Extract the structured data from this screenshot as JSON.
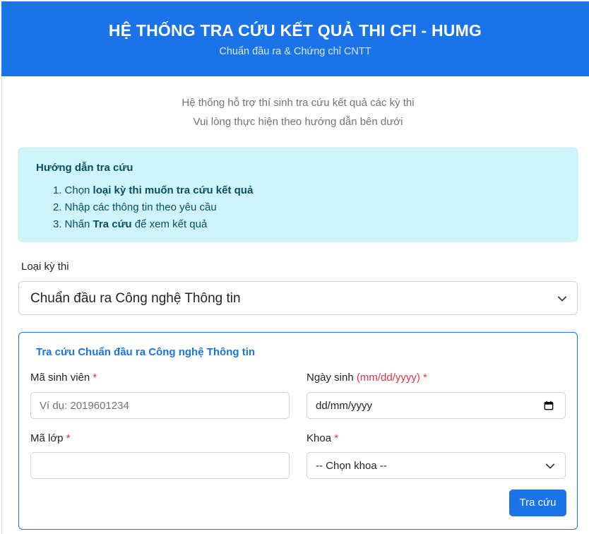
{
  "header": {
    "title": "HỆ THỐNG TRA CỨU KẾT QUẢ THI CFI - HUMG",
    "subtitle": "Chuẩn đầu ra & Chứng chỉ CNTT"
  },
  "intro": {
    "line1": "Hệ thống hỗ trợ thí sinh tra cứu kết quả các kỳ thi",
    "line2": "Vui lòng thực hiện theo hướng dẫn bên dưới"
  },
  "guide": {
    "heading": "Hướng dẫn tra cứu",
    "steps": [
      {
        "num": "1.",
        "pre": "Chọn ",
        "bold": "loại kỳ thi muốn tra cứu kết quả",
        "post": ""
      },
      {
        "num": "2.",
        "pre": "Nhập các thông tin theo yêu cầu",
        "bold": "",
        "post": ""
      },
      {
        "num": "3.",
        "pre": "Nhấn ",
        "bold": "Tra cứu",
        "post": " để xem kết quả"
      }
    ]
  },
  "exam_type": {
    "label": "Loại kỳ thi",
    "selected": "Chuẩn đầu ra Công nghệ Thông tin"
  },
  "form": {
    "title": "Tra cứu Chuẩn đầu ra Công nghệ Thông tin",
    "student_id": {
      "label": "Mã sinh viên",
      "required_mark": "*",
      "placeholder": "Ví dụ: 2019601234",
      "value": ""
    },
    "birthdate": {
      "label": "Ngày sinh",
      "format_hint": "(mm/dd/yyyy)",
      "required_mark": "*",
      "display": "dd/mm/yyyy"
    },
    "class_code": {
      "label": "Mã lớp",
      "required_mark": "*",
      "value": ""
    },
    "faculty": {
      "label": "Khoa",
      "required_mark": "*",
      "selected": "-- Chọn khoa --"
    },
    "submit_label": "Tra cứu"
  },
  "colors": {
    "primary": "#1a73e8",
    "alert_bg": "#cff4fc",
    "alert_text": "#055160",
    "required": "#dc3545"
  },
  "icons": {
    "select_arrow": "chevron-down-icon",
    "date_picker": "calendar-icon"
  }
}
